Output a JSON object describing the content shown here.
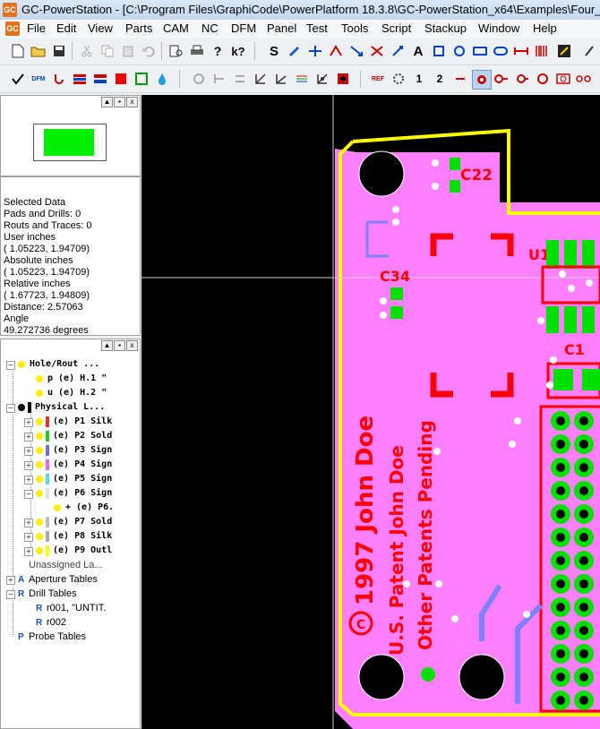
{
  "window": {
    "app_icon": "GC",
    "title": "GC-PowerStation - [C:\\Program Files\\GraphiCode\\PowerPlatform 18.3.8\\GC-PowerStation_x64\\Examples\\Four_l"
  },
  "menu": {
    "logo": "GC",
    "items": [
      "File",
      "Edit",
      "View",
      "Parts",
      "CAM",
      "NC",
      "DFM",
      "Panel",
      "Test",
      "Tools",
      "Script",
      "Stackup",
      "Window",
      "Help"
    ]
  },
  "info": {
    "lines": [
      "Selected Data",
      " Pads and Drills: 0",
      " Routs and Traces: 0",
      "User inches",
      " ( 1.05223,  1.94709)",
      "Absolute inches",
      " ( 1.05223,  1.94709)",
      "Relative inches",
      " ( 1.67723,  1.94809)",
      " Distance:  2.57063",
      "Angle",
      " 49.272736 degrees"
    ]
  },
  "tree": {
    "rows": [
      {
        "label": "Hole/Rout ...",
        "indent": 0,
        "exp": "-",
        "swatch": ""
      },
      {
        "label": "p (e) H.1 \"",
        "indent": 1,
        "exp": "",
        "swatch": ""
      },
      {
        "label": "u (e) H.2 \"",
        "indent": 1,
        "exp": "",
        "swatch": ""
      },
      {
        "label": "Physical L...",
        "indent": 0,
        "exp": "-",
        "swatch": "#000000"
      },
      {
        "label": "(e) P1 Silk",
        "indent": 1,
        "exp": "+",
        "swatch": "#e03030"
      },
      {
        "label": "(e) P2 Sold",
        "indent": 1,
        "exp": "+",
        "swatch": "#22cc22"
      },
      {
        "label": "(e) P3 Sign",
        "indent": 1,
        "exp": "+",
        "swatch": "#7070e0"
      },
      {
        "label": "(e) P4 Sign",
        "indent": 1,
        "exp": "+",
        "swatch": "#ee66ee"
      },
      {
        "label": "(e) P5 Sign",
        "indent": 1,
        "exp": "+",
        "swatch": "#55dddd"
      },
      {
        "label": "(e) P6 Sign",
        "indent": 1,
        "exp": "-",
        "swatch": "#e0e0e0"
      },
      {
        "label": "+ (e) P6.",
        "indent": 2,
        "exp": "",
        "swatch": ""
      },
      {
        "label": "(e) P7 Sold",
        "indent": 1,
        "exp": "+",
        "swatch": "#bbbbbb"
      },
      {
        "label": "(e) P8 Silk",
        "indent": 1,
        "exp": "+",
        "swatch": "#aaaaaa"
      },
      {
        "label": "(e) P9 Outl",
        "indent": 1,
        "exp": "+",
        "swatch": "#ffff00"
      },
      {
        "label": "Unassigned La...",
        "indent": 0,
        "exp": "",
        "swatch": ""
      },
      {
        "label": "Aperture Tables",
        "indent": 0,
        "exp": "+",
        "swatch": ""
      },
      {
        "label": "Drill Tables",
        "indent": 0,
        "exp": "-",
        "swatch": ""
      },
      {
        "label": "r001, \"UNTIT.",
        "indent": 1,
        "exp": "",
        "swatch": ""
      },
      {
        "label": "r002",
        "indent": 1,
        "exp": "",
        "swatch": ""
      },
      {
        "label": "Probe Tables",
        "indent": 0,
        "exp": "",
        "swatch": ""
      }
    ]
  },
  "pcb": {
    "labels": {
      "c22": "C22",
      "c34": "C34",
      "u1": "U1",
      "c1": "C1",
      "name_year": "1997 John Doe",
      "patent": "U.S. Patent John Doe",
      "pending": "Other Patents Pending",
      "copyright": "C"
    },
    "colors": {
      "board": "#ff80ff",
      "outline": "#ffff00",
      "silk": "#ff0000",
      "pad": "#00e000",
      "trace": "#8080ff",
      "background": "#000000"
    }
  },
  "icons": {
    "toolbar1": [
      "new-icon",
      "open-icon",
      "save-icon",
      "cut-icon",
      "copy-icon",
      "paste-icon",
      "undo-icon",
      "print-preview-icon",
      "print-icon",
      "help-icon",
      "whats-this-icon",
      "s-icon",
      "pen-icon",
      "component-icon",
      "connect-icon",
      "arrow-icon",
      "move-icon",
      "text-icon",
      "pad-square-icon",
      "pad-round-icon",
      "pad-rect-icon",
      "bar-icon",
      "barcode-icon",
      "picture-icon"
    ],
    "toolbar2": [
      "check-icon",
      "dfm-icon",
      "rout-icon",
      "stackup-icon",
      "layers-icon",
      "fill-red-icon",
      "fill-green-icon",
      "drop-icon",
      "snap-grid-icon",
      "snap-icon",
      "snap-midpoint-icon",
      "snap-end-icon",
      "measure-icon",
      "measure-angle-icon",
      "measure-rainbow-icon",
      "measure-center-icon",
      "stop-icon",
      "ref-icon",
      "copper-icon",
      "pin1-icon",
      "pin2-icon",
      "probe-icon",
      "via-icon",
      "trace-icon",
      "drill-icon",
      "pad-icon"
    ]
  }
}
